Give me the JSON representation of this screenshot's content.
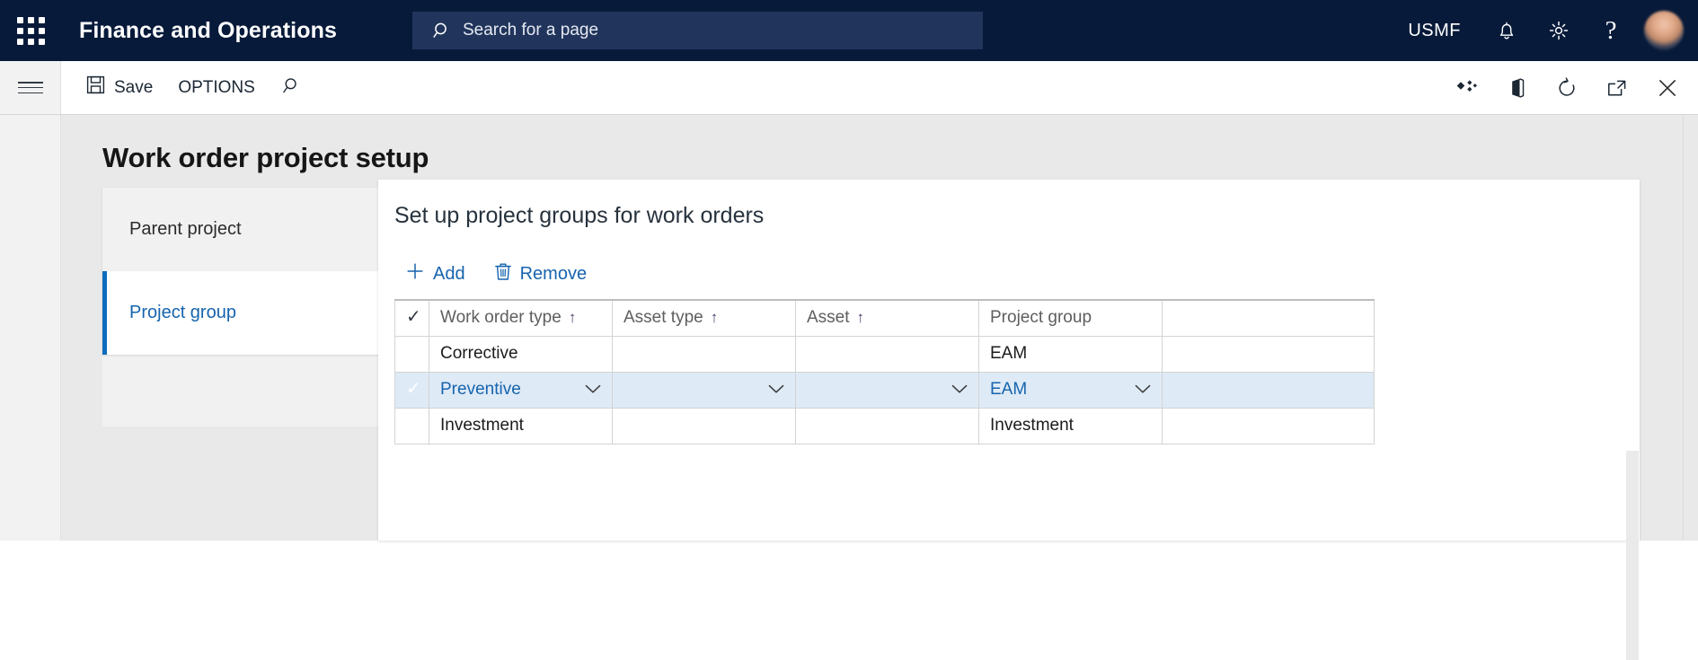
{
  "topbar": {
    "waffle_icon": "app-launcher-icon",
    "app_title": "Finance and Operations",
    "search": {
      "icon": "search-icon",
      "placeholder": "Search for a page",
      "value": ""
    },
    "company_code": "USMF",
    "icons": [
      {
        "name": "notifications-bell-icon",
        "label": "Notifications"
      },
      {
        "name": "settings-gear-icon",
        "label": "Settings"
      },
      {
        "name": "help-question-icon",
        "label": "Help",
        "glyph": "?"
      }
    ],
    "avatar": "user-avatar"
  },
  "commandbar": {
    "hamburger_icon": "navigation-menu-icon",
    "save_label": "Save",
    "save_icon": "save-disk-icon",
    "options_label": "OPTIONS",
    "search_icon": "filter-search-icon",
    "right_icons": [
      {
        "name": "personalize-diamond-icon"
      },
      {
        "name": "open-in-office-icon"
      },
      {
        "name": "refresh-icon"
      },
      {
        "name": "open-in-new-window-icon"
      },
      {
        "name": "close-icon"
      }
    ]
  },
  "page": {
    "title": "Work order project setup"
  },
  "tablist": {
    "items": [
      {
        "label": "Parent project",
        "selected": false
      },
      {
        "label": "Project group",
        "selected": true
      }
    ]
  },
  "panel": {
    "heading": "Set up project groups for work orders",
    "toolbar": {
      "add_label": "Add",
      "add_icon": "plus-icon",
      "remove_label": "Remove",
      "remove_icon": "trash-icon"
    },
    "grid": {
      "select_all_icon": "checkmark-icon",
      "sort_ascending_glyph": "↑",
      "dropdown_glyph": "⌄",
      "columns": [
        {
          "label": "Work order type",
          "sorted": true
        },
        {
          "label": "Asset type",
          "sorted": true
        },
        {
          "label": "Asset",
          "sorted": true
        },
        {
          "label": "Project group",
          "sorted": false
        }
      ],
      "rows": [
        {
          "selected": false,
          "work_order_type": "Corrective",
          "asset_type": "",
          "asset": "",
          "project_group": "EAM"
        },
        {
          "selected": true,
          "work_order_type": "Preventive",
          "asset_type": "",
          "asset": "",
          "project_group": "EAM"
        },
        {
          "selected": false,
          "work_order_type": "Investment",
          "asset_type": "",
          "asset": "",
          "project_group": "Investment"
        }
      ]
    }
  },
  "colors": {
    "nav_background": "#071a3a",
    "search_background": "#21355c",
    "accent_blue": "#0f6cbd",
    "link_blue": "#1664ae",
    "row_selected_background": "#deeaf6",
    "page_background": "#e9e9e9"
  }
}
